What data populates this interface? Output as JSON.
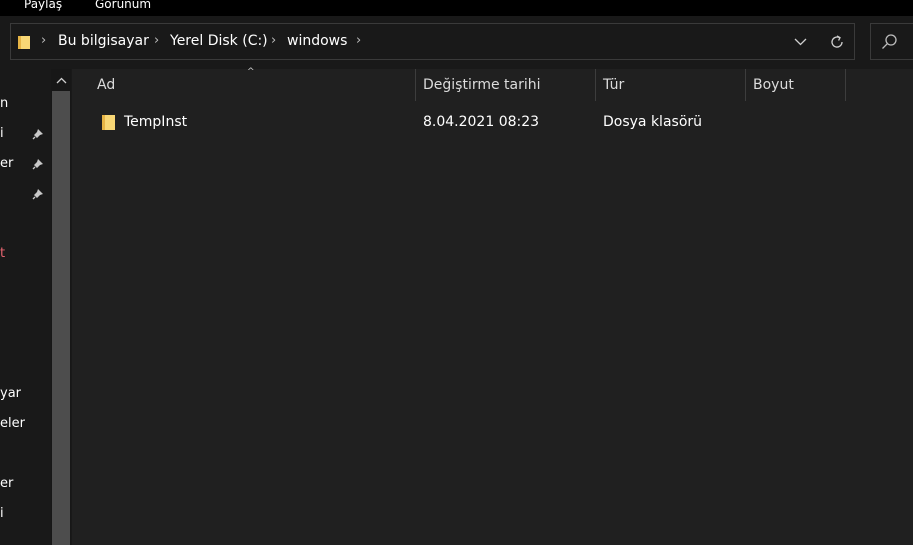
{
  "ribbon": {
    "tab_share": "Paylaş",
    "tab_view": "Görünüm"
  },
  "address_bar": {
    "folder_icon": "folder-icon",
    "crumbs": [
      "Bu bilgisayar",
      "Yerel Disk (C:)",
      "windows"
    ],
    "separator": ">",
    "history_icon": "chevron-down-icon",
    "refresh_icon": "refresh-icon"
  },
  "search": {
    "icon": "search-icon"
  },
  "nav_pane": {
    "items": [
      "n",
      "i",
      "er",
      "t",
      "yar",
      "eler",
      "er",
      "i"
    ]
  },
  "columns": [
    "Ad",
    "Değiştirme tarihi",
    "Tür",
    "Boyut"
  ],
  "files": [
    {
      "name": "TempInst",
      "modified": "8.04.2021 08:23",
      "type": "Dosya klasörü",
      "size": ""
    }
  ],
  "colors": {
    "background": "#202020",
    "folder": "#f8d775",
    "nav_accent_red": "#e5646f"
  }
}
